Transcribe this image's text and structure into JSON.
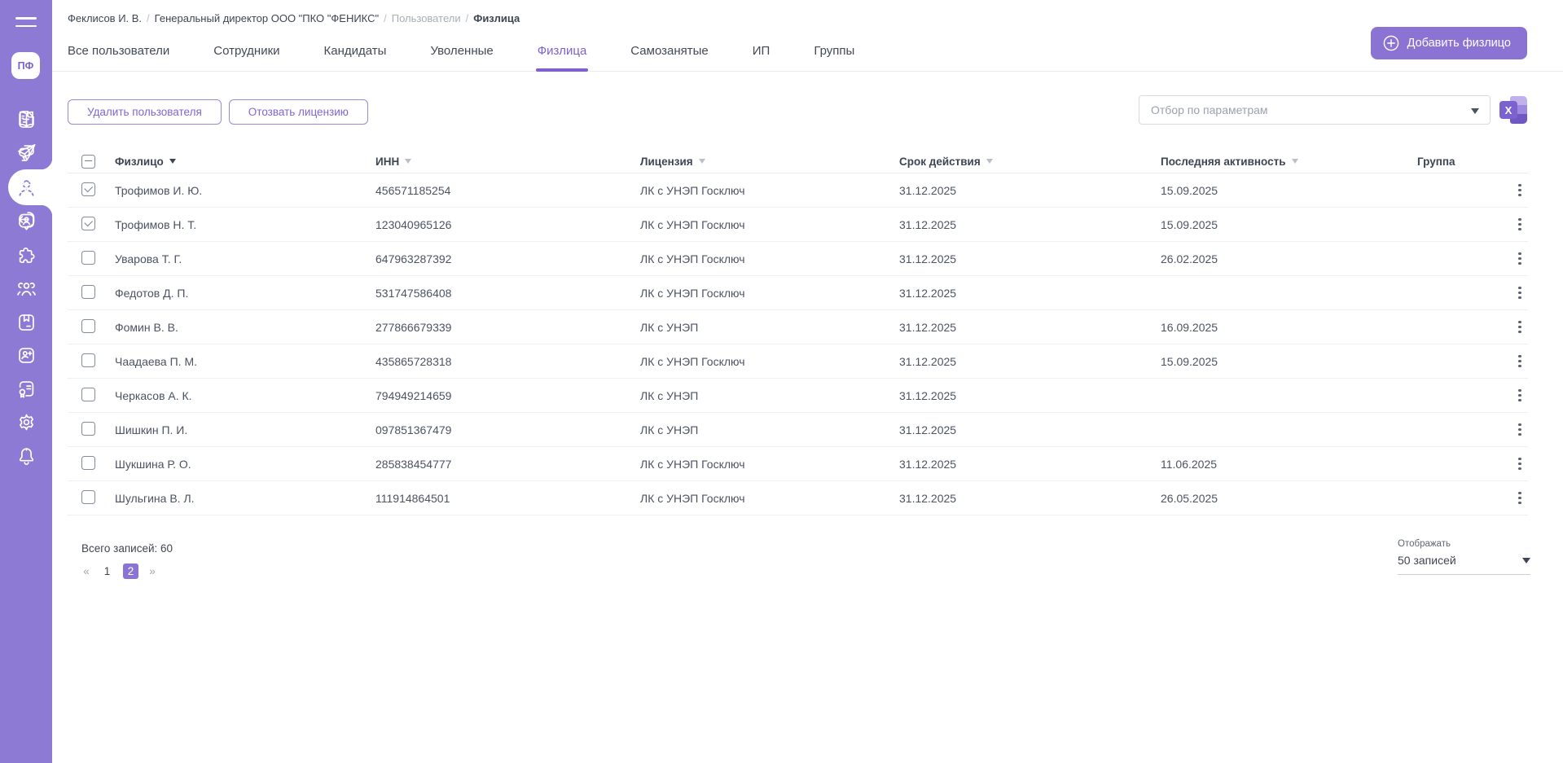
{
  "sidebar": {
    "logo_text": "ПФ",
    "menu_icon": "menu-icon",
    "nav_icons": [
      "document-icon",
      "send-icon",
      "person-icon",
      "contact-card-icon",
      "puzzle-icon",
      "people-icon",
      "archive-icon",
      "person-add-icon",
      "certificate-icon",
      "gear-icon",
      "bell-icon"
    ],
    "active_index": 2,
    "bottom_icons": [
      "book-icon",
      "support-chat-icon",
      "lock-icon",
      "logout-icon"
    ]
  },
  "breadcrumb": {
    "separator": "/",
    "items": [
      "Феклисов И. В.",
      "Генеральный директор ООО \"ПКО \"ФЕНИКС\"",
      "Пользователи",
      "Физлица"
    ]
  },
  "tabs": [
    {
      "label": "Все пользователи",
      "active": false
    },
    {
      "label": "Сотрудники",
      "active": false
    },
    {
      "label": "Кандидаты",
      "active": false
    },
    {
      "label": "Уволенные",
      "active": false
    },
    {
      "label": "Физлица",
      "active": true
    },
    {
      "label": "Самозанятые",
      "active": false
    },
    {
      "label": "ИП",
      "active": false
    },
    {
      "label": "Группы",
      "active": false
    }
  ],
  "add_button": {
    "label": "Добавить физлицо",
    "icon": "plus-circle-icon"
  },
  "toolbar": {
    "delete_user_label": "Удалить пользователя",
    "revoke_license_label": "Отозвать лицензию"
  },
  "filter": {
    "placeholder": "Отбор по параметрам",
    "excel_icon_letter": "X",
    "excel_icon": "excel-export-icon"
  },
  "table": {
    "header_checkbox": "indeterminate",
    "columns": [
      {
        "label": "Физлицо",
        "sort": "active"
      },
      {
        "label": "ИНН",
        "sort": "inactive"
      },
      {
        "label": "Лицензия",
        "sort": "inactive"
      },
      {
        "label": "Срок действия",
        "sort": "inactive"
      },
      {
        "label": "Последняя активность",
        "sort": "inactive"
      },
      {
        "label": "Группа",
        "sort": "none"
      }
    ],
    "rows": [
      {
        "name": "Трофимов И. Ю.",
        "inn": "456571185254",
        "license": "ЛК с УНЭП Госключ",
        "valid_until": "31.12.2025",
        "last_activity": "15.09.2025",
        "group": "",
        "checked": true
      },
      {
        "name": "Трофимов Н. Т.",
        "inn": "123040965126",
        "license": "ЛК с УНЭП Госключ",
        "valid_until": "31.12.2025",
        "last_activity": "15.09.2025",
        "group": "",
        "checked": true
      },
      {
        "name": "Уварова Т. Г.",
        "inn": "647963287392",
        "license": "ЛК с УНЭП Госключ",
        "valid_until": "31.12.2025",
        "last_activity": "26.02.2025",
        "group": "",
        "checked": false
      },
      {
        "name": "Федотов Д. П.",
        "inn": "531747586408",
        "license": "ЛК с УНЭП Госключ",
        "valid_until": "31.12.2025",
        "last_activity": "",
        "group": "",
        "checked": false
      },
      {
        "name": "Фомин В. В.",
        "inn": "277866679339",
        "license": "ЛК с УНЭП",
        "valid_until": "31.12.2025",
        "last_activity": "16.09.2025",
        "group": "",
        "checked": false
      },
      {
        "name": "Чаадаева П. М.",
        "inn": "435865728318",
        "license": "ЛК с УНЭП Госключ",
        "valid_until": "31.12.2025",
        "last_activity": "15.09.2025",
        "group": "",
        "checked": false
      },
      {
        "name": "Черкасов А. К.",
        "inn": "794949214659",
        "license": "ЛК с УНЭП",
        "valid_until": "31.12.2025",
        "last_activity": "",
        "group": "",
        "checked": false
      },
      {
        "name": "Шишкин П. И.",
        "inn": "097851367479",
        "license": "ЛК с УНЭП",
        "valid_until": "31.12.2025",
        "last_activity": "",
        "group": "",
        "checked": false
      },
      {
        "name": "Шукшина Р. О.",
        "inn": "285838454777",
        "license": "ЛК с УНЭП Госключ",
        "valid_until": "31.12.2025",
        "last_activity": "11.06.2025",
        "group": "",
        "checked": false
      },
      {
        "name": "Шульгина В. Л.",
        "inn": "111914864501",
        "license": "ЛК с УНЭП Госключ",
        "valid_until": "31.12.2025",
        "last_activity": "26.05.2025",
        "group": "",
        "checked": false
      }
    ]
  },
  "footer": {
    "total_label": "Всего записей: 60",
    "pagination": {
      "prev": "«",
      "next": "»",
      "pages": [
        "1",
        "2"
      ],
      "current": "2"
    },
    "page_size": {
      "label": "Отображать",
      "value": "50 записей"
    }
  },
  "colors": {
    "sidebar": "#8d7ad4",
    "accent": "#8b73d3",
    "active_tab": "#7e61ce"
  }
}
